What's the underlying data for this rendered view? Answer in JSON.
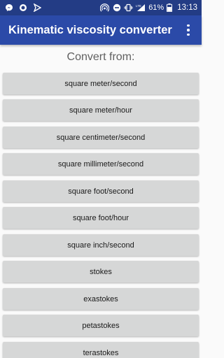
{
  "status_bar": {
    "icons_left": [
      "messenger-icon",
      "circle-icon",
      "send-icon"
    ],
    "battery": "61%",
    "time": "13:13",
    "network": "LTE"
  },
  "app_bar": {
    "title": "Kinematic viscosity converter"
  },
  "main": {
    "section_title": "Convert from:",
    "units": [
      "square meter/second",
      "square meter/hour",
      "square centimeter/second",
      "square millimeter/second",
      "square foot/second",
      "square foot/hour",
      "square inch/second",
      "stokes",
      "exastokes",
      "petastokes",
      "terastokes"
    ]
  },
  "colors": {
    "status_bar": "#233c85",
    "app_bar": "#2b4aa8",
    "button": "#d6d7d7"
  }
}
